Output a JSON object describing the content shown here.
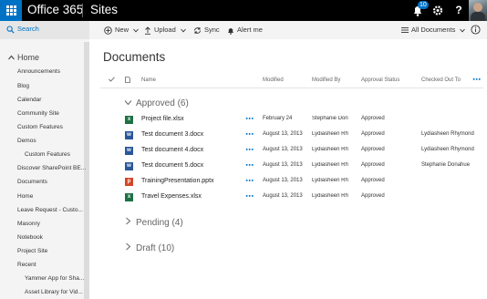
{
  "suite": {
    "brand": "Office 365",
    "app": "Sites",
    "notification_count": "10",
    "help_label": "?"
  },
  "search": {
    "label": "Search"
  },
  "nav": {
    "home": "Home",
    "items": [
      "Announcements",
      "Blog",
      "Calendar",
      "Community Site",
      "Custom Features",
      "Demos",
      "Custom Features",
      "Discover SharePoint BE...",
      "Documents",
      "Home",
      "Leave Request - Custo...",
      "Masonry",
      "Notebook",
      "Project Site",
      "Recent",
      "Yammer App for Sha...",
      "Asset Library for Vid..."
    ]
  },
  "commands": {
    "new": "New",
    "upload": "Upload",
    "sync": "Sync",
    "alert": "Alert me",
    "view": "All Documents"
  },
  "title": "Documents",
  "columns": {
    "name": "Name",
    "modified": "Modified",
    "modified_by": "Modified By",
    "approval": "Approval Status",
    "checked_out": "Checked Out To"
  },
  "groups": {
    "approved": "Approved (6)",
    "pending": "Pending (4)",
    "draft": "Draft (10)"
  },
  "rows": [
    {
      "name": "Project file.xlsx",
      "type": "xlsx",
      "modified": "February 24",
      "modified_by": "Stephanie Donahue",
      "status": "Approved",
      "checked_out": ""
    },
    {
      "name": "Test document 3.docx",
      "type": "docx",
      "modified": "August 13, 2013",
      "modified_by": "Lydiasheen Rhymond",
      "status": "Approved",
      "checked_out": "Lydiasheen Rhymond"
    },
    {
      "name": "Test document 4.docx",
      "type": "docx",
      "modified": "August 13, 2013",
      "modified_by": "Lydiasheen Rhymond",
      "status": "Approved",
      "checked_out": "Lydiasheen Rhymond"
    },
    {
      "name": "Test document 5.docx",
      "type": "docx",
      "modified": "August 13, 2013",
      "modified_by": "Lydiasheen Rhymond",
      "status": "Approved",
      "checked_out": "Stephanie Donahue"
    },
    {
      "name": "TrainingPresentation.pptx",
      "type": "pptx",
      "modified": "August 13, 2013",
      "modified_by": "Lydiasheen Rhymond",
      "status": "Approved",
      "checked_out": ""
    },
    {
      "name": "Travel Expenses.xlsx",
      "type": "xlsx",
      "modified": "August 13, 2013",
      "modified_by": "Lydiasheen Rhymond",
      "status": "Approved",
      "checked_out": ""
    }
  ],
  "colors": {
    "suite_bar": "#000000",
    "accent": "#0072c6",
    "nav_bg": "#f4f4f4"
  }
}
